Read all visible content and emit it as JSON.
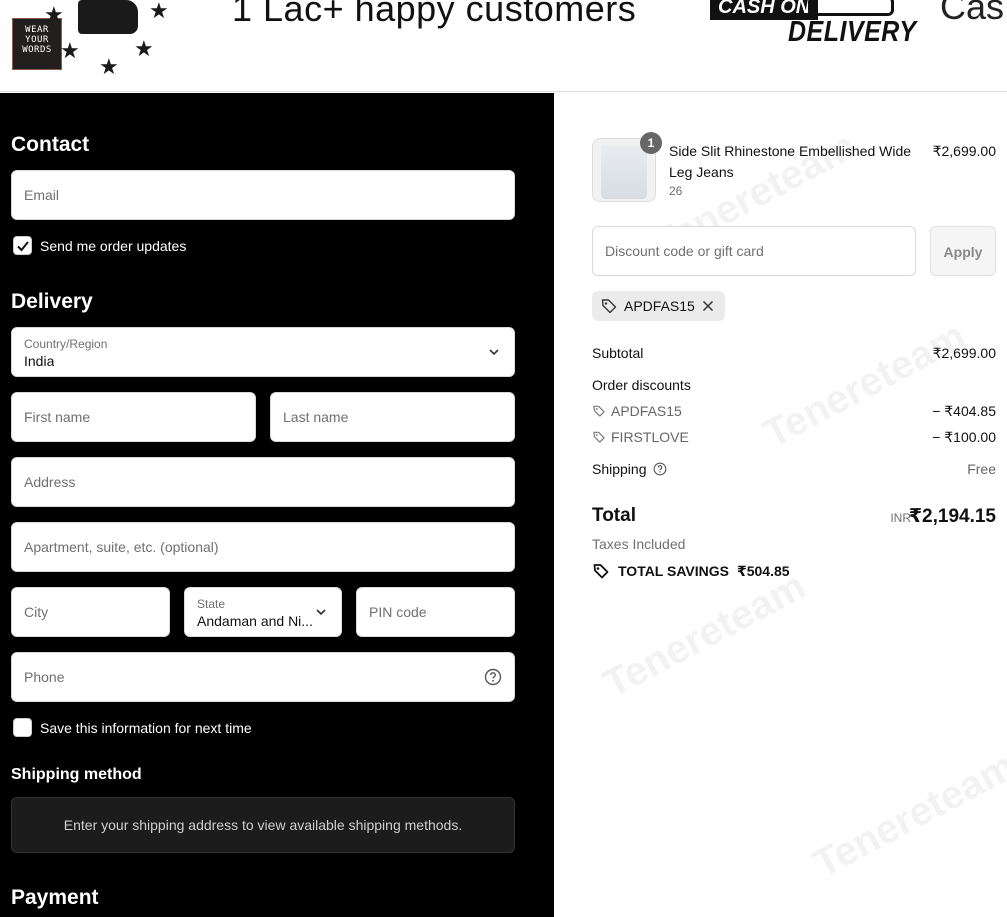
{
  "banner": {
    "logo_lines": [
      "WEAR",
      "YOUR",
      "WORDS"
    ],
    "tagline": "1 Lac+ happy customers",
    "cod_top": "CASH ON",
    "cod_bottom": "DELIVERY",
    "cut_text": "Cas"
  },
  "contact": {
    "heading": "Contact",
    "email_placeholder": "Email",
    "updates_label": "Send me order updates",
    "updates_checked": true
  },
  "delivery": {
    "heading": "Delivery",
    "country_label": "Country/Region",
    "country_value": "India",
    "first_name_placeholder": "First name",
    "last_name_placeholder": "Last name",
    "address_placeholder": "Address",
    "apartment_placeholder": "Apartment, suite, etc. (optional)",
    "city_placeholder": "City",
    "state_label": "State",
    "state_value": "Andaman and Ni...",
    "pin_placeholder": "PIN code",
    "phone_placeholder": "Phone",
    "save_label": "Save this information for next time",
    "save_checked": false
  },
  "shipping": {
    "heading": "Shipping method",
    "message": "Enter your shipping address to view available shipping methods."
  },
  "payment": {
    "heading": "Payment"
  },
  "order": {
    "quantity": "1",
    "product_name": "Side Slit Rhinestone Embellished Wide Leg Jeans",
    "variant": "26",
    "price": "₹2,699.00",
    "discount_placeholder": "Discount code or gift card",
    "apply_label": "Apply",
    "applied_code": "APDFAS15",
    "subtotal_label": "Subtotal",
    "subtotal_value": "₹2,699.00",
    "order_discounts_label": "Order discounts",
    "discounts": [
      {
        "code": "APDFAS15",
        "amount": "− ₹404.85"
      },
      {
        "code": "FIRSTLOVE",
        "amount": "− ₹100.00"
      }
    ],
    "shipping_label": "Shipping",
    "shipping_value": "Free",
    "total_label": "Total",
    "total_currency": "INR",
    "total_value": "₹2,194.15",
    "taxes_label": "Taxes Included",
    "savings_label": "TOTAL SAVINGS",
    "savings_value": "₹504.85"
  },
  "watermark_text": "Tenereteam",
  "colors": {
    "left_bg": "#000000",
    "right_bg": "#ffffff",
    "field_bg": "#ffffff"
  }
}
